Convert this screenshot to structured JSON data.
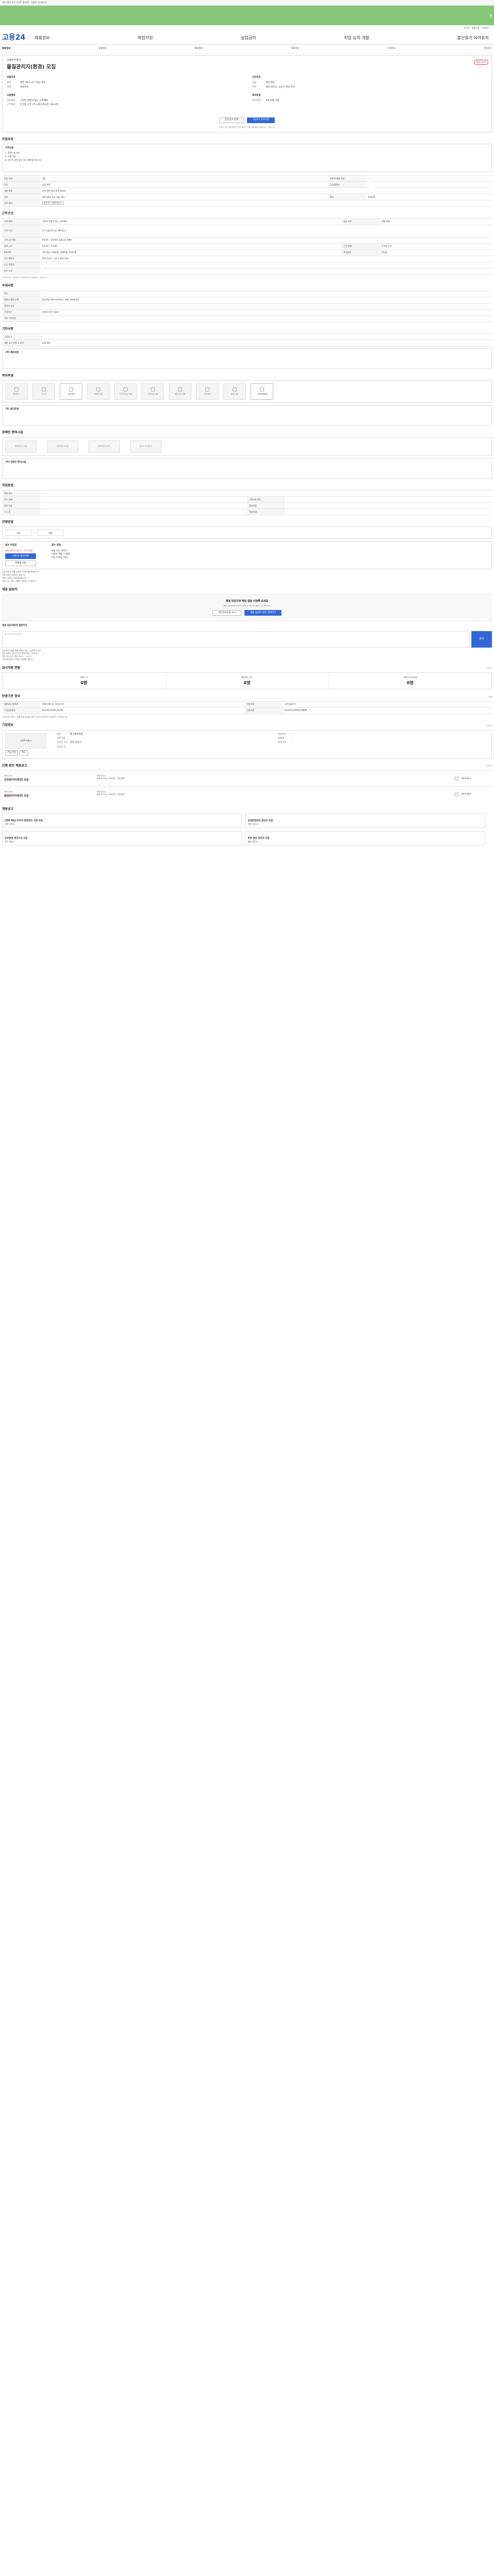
{
  "topbar": {
    "notice": "고용노동부 공식 사이트 제공하는 고용24 안내입니다",
    "links": [
      "로그인",
      "회원가입",
      "고객센터"
    ]
  },
  "logo": "고용24",
  "gnb": [
    "채용정보",
    "취업지원",
    "실업급여",
    "직업 능력 개발",
    "출산휴가·육아휴직"
  ],
  "lnb": [
    "채용정보",
    "공채정보",
    "채용행사",
    "해외취업",
    "인재정보",
    "기업정보"
  ],
  "job": {
    "company": "사복주식회사",
    "title": "물질관리자(환경) 모집",
    "dday": "채용시까지",
    "company_info_title": "지원자격",
    "company_kv": [
      {
        "k": "경력",
        "v": "경력 (최소 3년 이상) 필수"
      },
      {
        "k": "학력",
        "v": "학력무관"
      }
    ],
    "work_info_title": "근무조건",
    "work_kv": [
      {
        "k": "임금",
        "v": "연봉 협의"
      },
      {
        "k": "지역",
        "v": "전북 익산시, 고산구 관리 지역"
      }
    ],
    "h_kv2_title": "고용형태",
    "h_kv2": [
      {
        "k": "고용형태",
        "v": "기간의 정함이 없는 근로계약"
      },
      {
        "k": "근무형태",
        "v": "주 5일 근무 (주 소정근로시간: 40시간)"
      }
    ],
    "h_kv3_title": "복리후생",
    "h_kv3": [
      {
        "k": "복리후생",
        "v": "4대 보험 가입"
      }
    ],
    "btn_scrap": "관심공고 등록",
    "btn_apply": "고용24 입사지원",
    "note": "고용24 입사지원 버튼이 있는 공고는 고용24를 통해 지원하실 수 있습니다."
  },
  "sec_recruit": {
    "title": "모집요강",
    "job_box_title": "직무내용",
    "job_lines": [
      "1. 환경시설 관리",
      "2. 보험 작성",
      "3. 인허가 관련 업무 처리 (폐기물 처리 등)"
    ],
    "rows": [
      {
        "k": "모집 인원",
        "v": "1명",
        "k2": "영업직 채용 인원",
        "v2": "-"
      },
      {
        "k": "직무",
        "v": "공업 화학",
        "k2": "근무예정지",
        "v2": "-"
      },
      {
        "k": "채용 직종",
        "v": "조직 관련 환경 안전 관리자",
        "k2": "",
        "v2": ""
      },
      {
        "k": "경력",
        "v": "경력 (최소 3년 이상) 필수",
        "k2": "학력",
        "v2": "학력무관"
      },
      {
        "k": "자격 면허",
        "v": "환경기사 / 환경산업기사",
        "k2": "",
        "v2": ""
      }
    ]
  },
  "sec_work": {
    "title": "근무조건",
    "rows": [
      {
        "k": "고용 형태",
        "v": "기간의 정함이 없는 근로계약",
        "k2": "임금 조건",
        "v2": "연봉 협의"
      },
      {
        "k": "근무 시간",
        "v": "(주 소정근로시간: 40시간)",
        "k2": "",
        "v2": ""
      },
      {
        "k": "근로시간 예시",
        "v": "09:00 ~ 18:00 (휴게시간 60분)",
        "k2": "",
        "v2": ""
      },
      {
        "k": "휴게 시간",
        "v": "12:00 ~ 13:00",
        "k2": "근무 형태",
        "v2": "주 5일 근무"
      },
      {
        "k": "4대보험",
        "v": "국민연금, 고용보험, 산재보험, 건강보험",
        "k2": "퇴직급여",
        "v2": "퇴직금"
      },
      {
        "k": "근무 예정지",
        "v": "전북 익산시, 고산구 관리 지역",
        "k2": "",
        "v2": ""
      },
      {
        "k": "인근 전철역",
        "v": "-",
        "k2": "",
        "v2": ""
      },
      {
        "k": "버스 노선",
        "v": "-",
        "k2": "",
        "v2": ""
      }
    ],
    "note": "근로조건은 사업장의 사정에 따라 변경될 수 있습니다."
  },
  "sec_pref": {
    "title": "우대사항",
    "rows": [
      {
        "k": "전공",
        "v": "-"
      },
      {
        "k": "컴퓨터 활용 능력",
        "v": "문서작성 (워드프로세서), 엑셀, 파워포인트"
      },
      {
        "k": "외국어 능력",
        "v": "-"
      },
      {
        "k": "우대조건",
        "v": "자동차 운전 가능자"
      },
      {
        "k": "기타 우대사항",
        "v": "-"
      }
    ]
  },
  "sec_etc": {
    "title": "기타사항",
    "rows": [
      {
        "k": "근로자 수",
        "v": "-"
      },
      {
        "k": "채용 공고 등록 시 조건",
        "v": "사용 여부"
      }
    ],
    "box_title": "기타 채용내용",
    "box_text": ""
  },
  "sec_benefit": {
    "title": "복리후생",
    "items": [
      "통근버스",
      "기숙사",
      "4대 보험",
      "교육비 지원",
      "자녀 학자금 지원",
      "주택자금 지원",
      "경조사비 지원",
      "건강검진",
      "명절 선물",
      "자녀보육지원"
    ],
    "active": [
      2,
      9
    ],
    "text_title": "기타 복리후생",
    "text": ""
  },
  "sec_access": {
    "title": "장애인 편의시설",
    "items": [
      "장애인용 주차장",
      "장애인용 화장실",
      "장애인용 승강기",
      "경사로 및 출입구"
    ],
    "text_title": "기타 장애인 편의시설",
    "text": ""
  },
  "sec_env": {
    "title": "작업환경",
    "rows": [
      {
        "k": "작업 장소",
        "v": "-",
        "k2": "",
        "v2": ""
      },
      {
        "k": "조도 상태",
        "v": "-",
        "k2": "시력사용 정도",
        "v2": "-"
      },
      {
        "k": "청각 사용",
        "v": "-",
        "k2": "양손작업",
        "v2": "-"
      },
      {
        "k": "드는 힘",
        "v": "-",
        "k2": "작업자세",
        "v2": "-"
      }
    ]
  },
  "sec_process": {
    "title": "전형방법",
    "steps": [
      "서류",
      "면접"
    ],
    "apply_title": "접수 마감일",
    "apply_date": "채용시까지 (마감시 - 조기 마감)",
    "apply_btn": "고용24 입사지원",
    "apply_btn2": "이메일 지원",
    "doc_title": "접수 방법",
    "doc_lines": [
      "제출 서류: 이력서",
      "이메일 (제출 시 제출)",
      "서류 (이메일 지원)"
    ],
    "notes": [
      "입사 지원 후 채용 담당자가 지원서를 확인합니다.",
      "지원 서류는 반환되지 않습니다.",
      "채용 시 결과는 개별 통보합니다.",
      "허위 사실 기재 시 채용이 취소될 수 있습니다."
    ]
  },
  "sec_contact": {
    "title": "채용 담당자",
    "box_title": "채용 담당자와 채팅 앱을 이용해 보세요",
    "box_note": "채용 담당자에게 문의하시려면 로그인 후 이용하시기 바랍니다.",
    "btn1": "개인정보동의 보기",
    "btn2": "채용 담당자 문의 입력하기",
    "q_title": "채용 담당자에게 질문하기",
    "q_placeholder": "질문 내용을 입력하세요.",
    "q_btn": "문의",
    "lines": [
      "개인정보 보호를 위해 이메일 작성 시 유의해 주세요.",
      "질의 내용은 24시간 이내 답변 받을 수 있습니다.",
      "연락 가능 시간: 평일 09:00 ~ 18:00",
      "구인기업 정보는 고용24 정보를 따릅니다."
    ]
  },
  "sec_apply_status": {
    "title": "입사지원 현황",
    "more": "더보기",
    "stats": [
      {
        "lbl": "지원자 수",
        "num": "0명"
      },
      {
        "lbl": "취업알선 건수",
        "num": "0명"
      },
      {
        "lbl": "고용24 입사지원",
        "num": "0명"
      }
    ]
  },
  "sec_reg": {
    "title": "인증기관 정보",
    "more": "인쇄",
    "rows": [
      {
        "k": "채용공고 등록일",
        "v": "2025.04.11 10:12:37",
        "k2": "인증기관",
        "v2": "공인인증(주)"
      },
      {
        "k": "구인인증번호",
        "v": "K151412504110100",
        "k2": "인증기관",
        "v2": "K1412112504110096"
      }
    ],
    "note": "구인인증 번호는 채용정보 발급을 위해 고용노동부에서 발급하는 번호입니다."
  },
  "sec_company": {
    "title": "기업정보",
    "more": "더보기",
    "name": "사복주식회사",
    "rows": [
      {
        "k": "업종",
        "v": "폐기물처리업"
      },
      {
        "k": "대표자명",
        "v": "-"
      },
      {
        "k": "사업장 주소",
        "v": "전북 익산시"
      },
      {
        "k": "근로자 수",
        "v": "-"
      }
    ],
    "rows2": [
      {
        "k": "설립년도",
        "v": "-"
      },
      {
        "k": "매출액",
        "v": "-"
      },
      {
        "k": "홈페이지",
        "v": "-"
      }
    ],
    "btn1": "관심기업",
    "btn2": "지도"
  },
  "sec_other": {
    "title": "진행 중인 채용공고",
    "more": "더보기",
    "rows": [
      {
        "badge": "채용시까지",
        "title": "안전관리자(환경) 모집",
        "loc": "전북 익산시",
        "tags": "경력 3년 이상 · 학력무관 · 연봉 협의",
        "co": "사복주식회사"
      },
      {
        "badge": "채용시까지",
        "title": "물질관리자(환경) 모집",
        "loc": "전북 익산시",
        "tags": "경력 3년 이상 · 학력무관 · 연봉 협의",
        "co": "사복주식회사"
      }
    ]
  },
  "sec_similar": {
    "title": "채용공고",
    "items": [
      {
        "tl": "[경력 채용] 부여치 환경관리 사원 모집",
        "sub": "전북 익산시"
      },
      {
        "tl": "공정환경관리 담당자 모집",
        "sub": "전북 익산시"
      },
      {
        "tl": "토목환경 엔지니어 모집",
        "sub": "경기 화성시"
      },
      {
        "tl": "환경 담당 관리자 모집",
        "sub": "충남 당진시"
      }
    ]
  }
}
